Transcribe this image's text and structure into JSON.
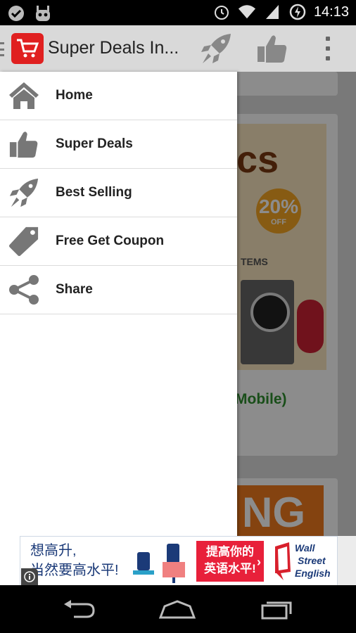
{
  "status_bar": {
    "time": "14:13",
    "left_icons": [
      "checkmark-badge-icon",
      "android-robot-icon"
    ],
    "right_icons": [
      "alarm-icon",
      "wifi-icon",
      "signal-icon",
      "battery-charging-icon"
    ]
  },
  "action_bar": {
    "title": "Super Deals In...",
    "logo_icon": "shopping-cart-icon",
    "action_icons": [
      "rocket-icon",
      "thumbs-up-icon"
    ],
    "overflow_icon": "overflow-menu-icon"
  },
  "drawer": {
    "items": [
      {
        "label": "Home",
        "icon": "home-icon"
      },
      {
        "label": "Super Deals",
        "icon": "thumbs-up-icon"
      },
      {
        "label": "Best Selling",
        "icon": "rocket-icon"
      },
      {
        "label": "Free Get Coupon",
        "icon": "tag-icon"
      },
      {
        "label": "Share",
        "icon": "share-icon"
      }
    ]
  },
  "background": {
    "banner_big_text": "cs",
    "badge_text": "20%",
    "badge_sub": "OFF",
    "items_text": "TEMS",
    "product_link_fragment": "Mobile)",
    "orange_banner_text": "NG"
  },
  "ad": {
    "line1": "想高升,",
    "line2": "当然要高水平!",
    "cta_line1": "提高你的",
    "cta_line2": "英语水平!",
    "cta_arrow": "›",
    "brand_line1": "Wall",
    "brand_line2": "Street",
    "brand_line3": "English",
    "info_icon": "info-icon"
  },
  "nav_bar": {
    "buttons": [
      "back-icon",
      "home-icon",
      "recent-apps-icon"
    ]
  },
  "colors": {
    "accent_red": "#e02020",
    "action_bar_bg": "#d9d9d9",
    "drawer_bg": "#ffffff",
    "icon_gray": "#777777"
  }
}
